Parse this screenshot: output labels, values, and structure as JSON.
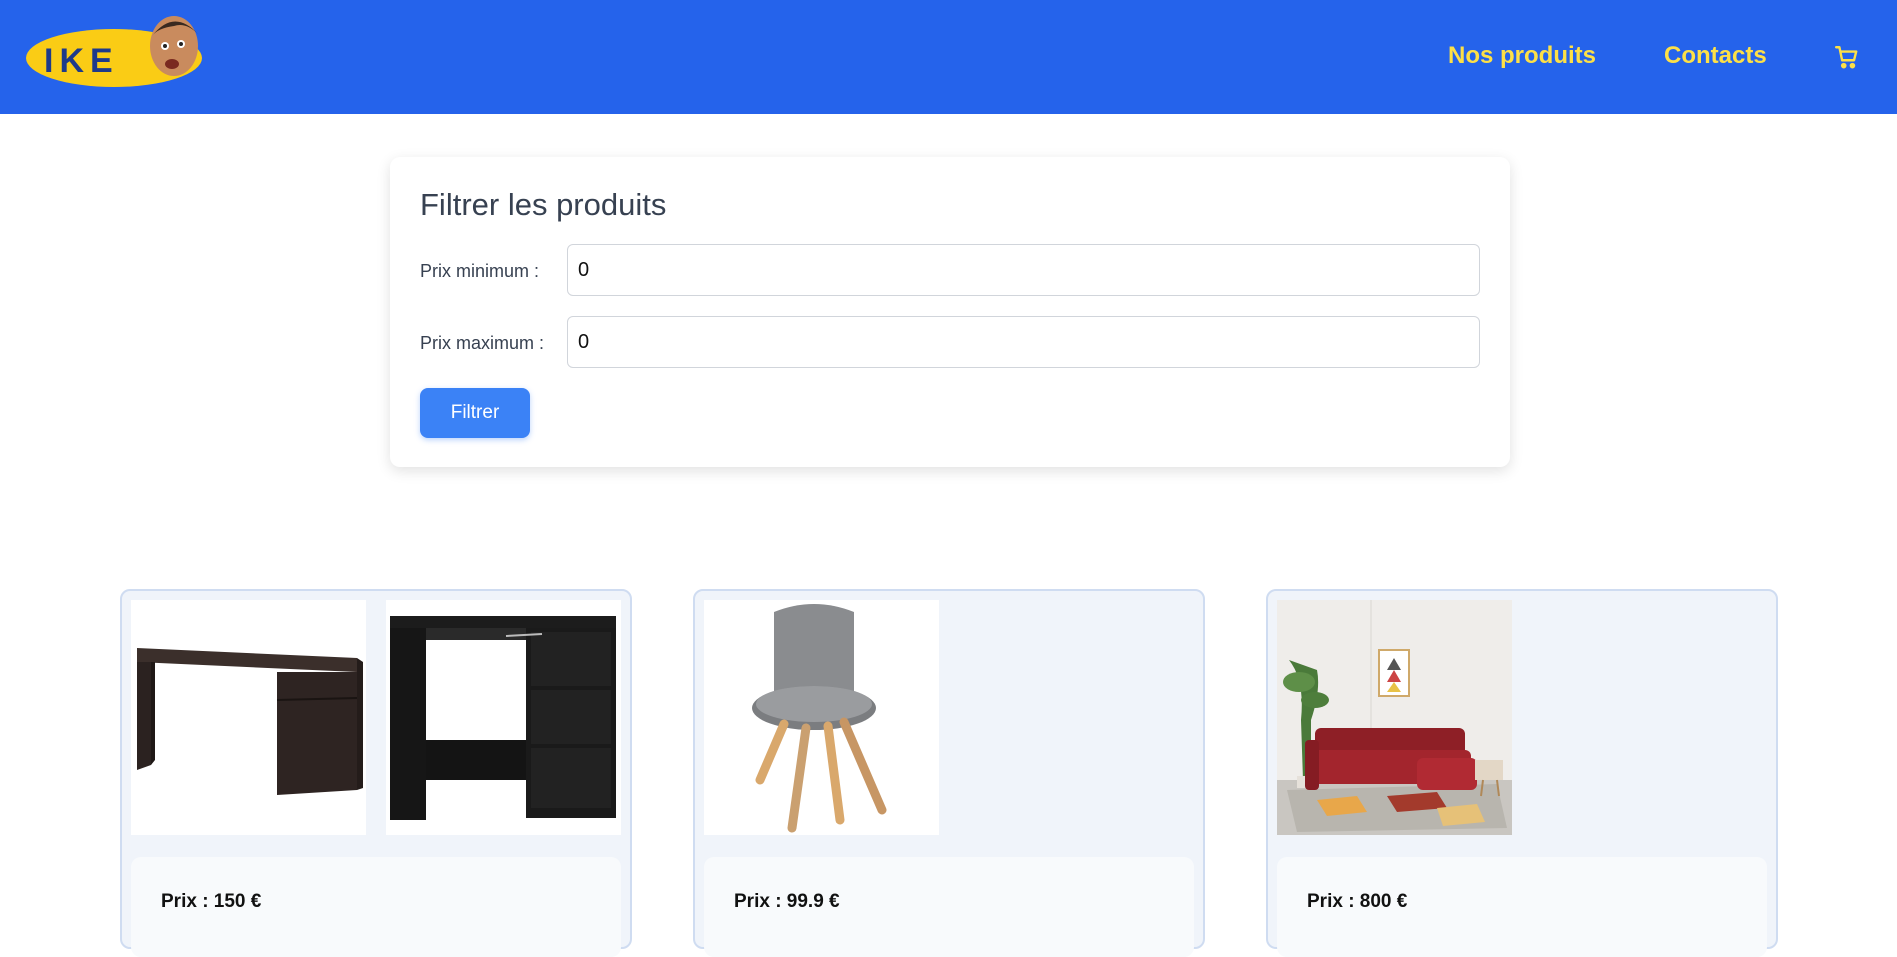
{
  "header": {
    "logo_text": "IKE",
    "nav": [
      {
        "label": "Nos produits"
      },
      {
        "label": "Contacts"
      }
    ],
    "cart_icon": "shopping-cart-icon",
    "colors": {
      "background": "#2563eb",
      "link": "#fde047"
    }
  },
  "filter": {
    "title": "Filtrer les produits",
    "min_label": "Prix minimum :",
    "min_value": "0",
    "max_label": "Prix maximum :",
    "max_value": "0",
    "button_label": "Filtrer",
    "button_color": "#3b82f6"
  },
  "products": [
    {
      "price_label": "Prix : 150 €",
      "images": [
        "desk-dark-brown-image",
        "desk-black-drawers-image"
      ]
    },
    {
      "price_label": "Prix : 99.9 €",
      "images": [
        "grey-chair-image"
      ]
    },
    {
      "price_label": "Prix : 800 €",
      "images": [
        "red-sofa-image"
      ]
    }
  ]
}
